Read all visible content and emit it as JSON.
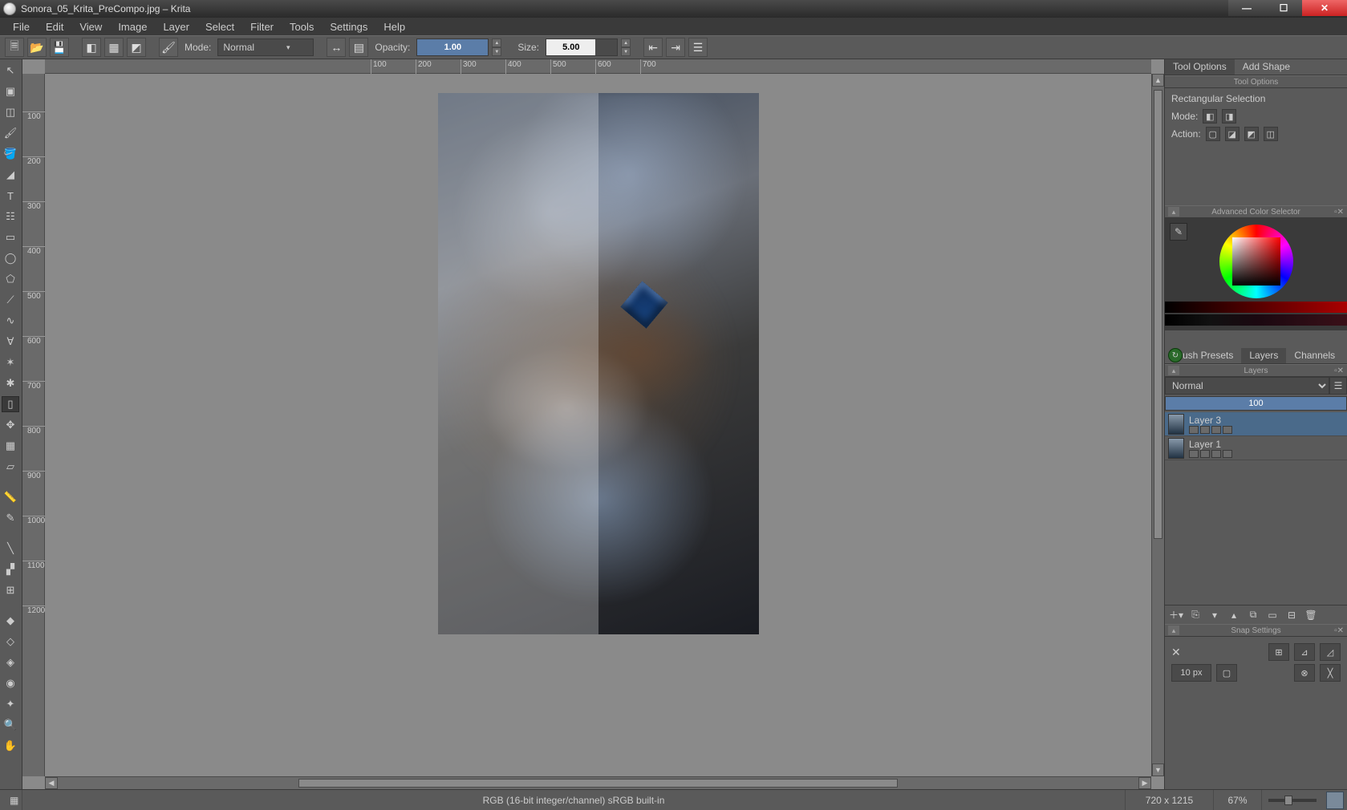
{
  "window": {
    "title": "Sonora_05_Krita_PreCompo.jpg – Krita"
  },
  "menu": {
    "items": [
      "File",
      "Edit",
      "View",
      "Image",
      "Layer",
      "Select",
      "Filter",
      "Tools",
      "Settings",
      "Help"
    ]
  },
  "toolbar": {
    "mode_label": "Mode:",
    "mode_value": "Normal",
    "opacity_label": "Opacity:",
    "opacity_value": "1.00",
    "size_label": "Size:",
    "size_value": "5.00"
  },
  "ruler_h": {
    "ticks": [
      100,
      200,
      300,
      400,
      500,
      600,
      700
    ]
  },
  "ruler_v": {
    "ticks": [
      100,
      200,
      300,
      400,
      500,
      600,
      700,
      800,
      900,
      1000,
      1100,
      1200
    ]
  },
  "right": {
    "tabs": {
      "options": "Tool Options",
      "addshape": "Add Shape"
    },
    "tooloptions": {
      "header": "Tool Options",
      "heading": "Rectangular Selection",
      "mode_label": "Mode:",
      "action_label": "Action:"
    },
    "colorselector": {
      "header": "Advanced Color Selector"
    },
    "layers": {
      "tabs": {
        "presets": "Brush Presets",
        "layers": "Layers",
        "channels": "Channels"
      },
      "header": "Layers",
      "blend": "Normal",
      "opacity": "100",
      "list": [
        {
          "name": "Layer 3"
        },
        {
          "name": "Layer 1"
        }
      ]
    },
    "snap": {
      "header": "Snap Settings",
      "px": "10 px"
    }
  },
  "status": {
    "colorspace": "RGB (16-bit integer/channel)  sRGB built-in",
    "dims": "720 x 1215",
    "zoom": "67%"
  }
}
